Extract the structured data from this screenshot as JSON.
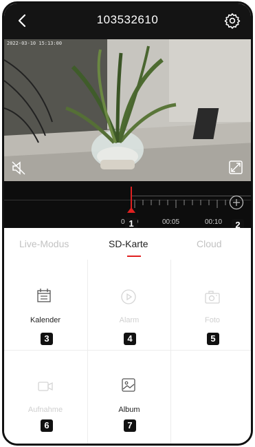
{
  "header": {
    "title": "103532610",
    "back_icon": "chevron-left-icon",
    "settings_icon": "gear-icon"
  },
  "video": {
    "timestamp": "2022-03-10 15:13:00",
    "mute_icon": "speaker-mute-icon",
    "fullscreen_icon": "fullscreen-icon"
  },
  "timeline": {
    "times": [
      "00:00",
      "00:05",
      "00:10"
    ],
    "zoom_icon": "zoom-in-icon",
    "cursor_color": "#e02020"
  },
  "badges": [
    "1",
    "2",
    "3",
    "4",
    "5",
    "6",
    "7"
  ],
  "tabs": [
    {
      "label": "Live-Modus",
      "active": false
    },
    {
      "label": "SD-Karte",
      "active": true
    },
    {
      "label": "Cloud",
      "active": false
    }
  ],
  "grid": [
    {
      "label": "Kalender",
      "icon": "calendar-icon",
      "enabled": true
    },
    {
      "label": "Alarm",
      "icon": "alarm-play-icon",
      "enabled": false
    },
    {
      "label": "Foto",
      "icon": "photo-camera-icon",
      "enabled": false
    },
    {
      "label": "Aufnahme",
      "icon": "video-record-icon",
      "enabled": false
    },
    {
      "label": "Album",
      "icon": "album-icon",
      "enabled": true
    }
  ],
  "colors": {
    "accent": "#e02020",
    "header_bg": "#141414",
    "timeline_bg": "#0d0d0d"
  }
}
